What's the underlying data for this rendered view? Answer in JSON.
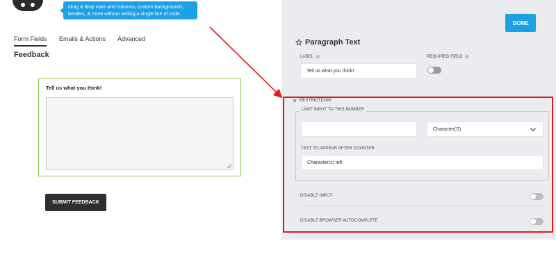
{
  "tooltip": {
    "line1": "Drag & drop rows and columns, custom backgrounds,",
    "line2": "borders, & more without writing a single line of code."
  },
  "tabs": [
    "Form Fields",
    "Emails & Actions",
    "Advanced"
  ],
  "form": {
    "title": "Feedback",
    "field_label": "Tell us what you think!",
    "submit_label": "SUBMIT FEEDBACK"
  },
  "panel": {
    "done_label": "DONE",
    "title": "Paragraph Text",
    "label_caption": "LABEL",
    "label_value": "Tell us what you think!",
    "required_caption": "REQUIRED FIELD",
    "restrictions_caption": "RESTRICTIONS",
    "limit_caption": "LIMIT INPUT TO THIS NUMBER",
    "limit_value": "",
    "limit_unit": "Character(S)",
    "counter_caption": "TEXT TO APPEAR AFTER COUNTER",
    "counter_value": "Character(s) left",
    "disable_input_caption": "DISABLE INPUT",
    "disable_autocomplete_caption": "DISABLE BROWSER AUTOCOMPLETE"
  },
  "colors": {
    "accent": "#1ea1e4",
    "highlight_frame": "#e0191f",
    "active_field_border": "#8bc34a"
  }
}
